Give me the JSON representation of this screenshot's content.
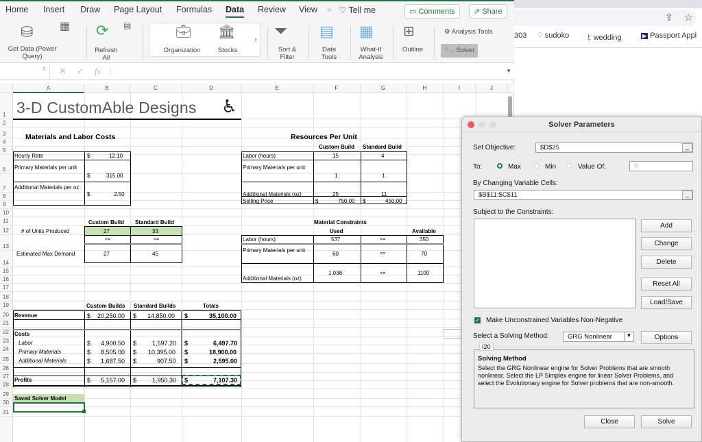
{
  "browser": {
    "bookmarks": [
      {
        "label": "303",
        "icon": "page-icon"
      },
      {
        "label": "sudoko",
        "icon": "bulb-icon"
      },
      {
        "label": "wedding",
        "icon": "wedding-icon"
      },
      {
        "label": "Passport Appl",
        "icon": "usps-icon"
      }
    ],
    "share_icon": "share-icon",
    "star_icon": "star-icon"
  },
  "excel": {
    "menu_tabs": [
      "Home",
      "Insert",
      "Draw",
      "Page Layout",
      "Formulas",
      "Data",
      "Review",
      "View"
    ],
    "active_tab": "Data",
    "tell_me": "Tell me",
    "comments_label": "Comments",
    "share_label": "Share",
    "ribbon": {
      "get_data": "Get Data (Power Query)",
      "refresh_all": "Refresh All",
      "organization": "Organization",
      "stocks": "Stocks",
      "sort_filter": "Sort & Filter",
      "data_tools": "Data Tools",
      "what_if": "What-If Analysis",
      "outline": "Outline",
      "analysis_tools": "Analysis Tools",
      "solver": "Solver"
    },
    "formula_bar": {
      "name_box": "",
      "fx": "fx",
      "value": ""
    },
    "columns": [
      "A",
      "B",
      "C",
      "D",
      "E",
      "F",
      "G",
      "H",
      "I",
      "J"
    ],
    "selected_column": "A",
    "rows": [
      "1",
      "2",
      "3",
      "4",
      "5",
      "6",
      "7",
      "8",
      "9",
      "10",
      "11",
      "12",
      "13",
      "14",
      "15",
      "16",
      "17",
      "18",
      "19",
      "20",
      "21",
      "22",
      "23",
      "24",
      "25",
      "26",
      "27",
      "28",
      "29",
      "30",
      "31"
    ],
    "selected_row": "28",
    "sheet": {
      "title": "3-D CustomAble Designs",
      "logo_icon": "wheelchair-icon",
      "materials": {
        "heading": "Materials and Labor Costs",
        "rows": [
          {
            "label": "Hourly Rate",
            "cur": "$",
            "value": "12.10"
          },
          {
            "label": "Primary Materials per unit",
            "cur": "$",
            "value": "315.00"
          },
          {
            "label": "Additional Materials per oz",
            "cur": "$",
            "value": "2.50"
          }
        ]
      },
      "resources": {
        "heading": "Resources Per Unit",
        "col1": "Custom Build",
        "col2": "Standard Build",
        "rows": [
          {
            "label": "Labor (hours)",
            "custom": "15",
            "standard": "4"
          },
          {
            "label": "Primary Materials per unit",
            "custom": "1",
            "standard": "1"
          },
          {
            "label": "Additional Materials (oz)",
            "custom": "25",
            "standard": "11"
          },
          {
            "label": "Selling Price",
            "custom": "750.00",
            "standard": "450.00",
            "cur": "$"
          }
        ]
      },
      "production": {
        "col1": "Custom Build",
        "col2": "Standard Build",
        "units_label": "# of Units Produced",
        "units_custom": "27",
        "units_standard": "33",
        "le_symbol": "<=",
        "demand_label": "Estimated Max Demand",
        "demand_custom": "27",
        "demand_standard": "45"
      },
      "constraints": {
        "heading": "Material Constraints",
        "used_header": "Used",
        "available_header": "Available",
        "rows": [
          {
            "label": "Labor (hours)",
            "used": "537",
            "op": "<=",
            "available": "350"
          },
          {
            "label": "Primary Materials per unit",
            "used": "60",
            "op": "<=",
            "available": "70"
          },
          {
            "label": "Additional Materials (oz)",
            "used": "1,038",
            "op": "<=",
            "available": "1100"
          }
        ]
      },
      "financials": {
        "headers": [
          "Custom Builds",
          "Standard Builds",
          "Totals"
        ],
        "revenue": {
          "label": "Revenue",
          "custom": "20,250.00",
          "standard": "14,850.00",
          "total": "35,100.00"
        },
        "costs_label": "Costs",
        "costs": [
          {
            "label": "Labor",
            "custom": "4,900.50",
            "standard": "1,597.20",
            "total": "6,497.70"
          },
          {
            "label": "Primary Materials",
            "custom": "8,505.00",
            "standard": "10,395.00",
            "total": "18,900.00"
          },
          {
            "label": "Additional Materials",
            "custom": "1,687.50",
            "standard": "907.50",
            "total": "2,595.00"
          }
        ],
        "profits": {
          "label": "Profits",
          "custom": "5,157.00",
          "standard": "1,950.30",
          "total": "7,107.30"
        },
        "cur": "$"
      },
      "saved_model_label": "Saved Solver Model"
    }
  },
  "solver": {
    "title": "Solver Parameters",
    "set_objective_label": "Set Objective:",
    "set_objective_value": "$D$25",
    "to_label": "To:",
    "options": [
      {
        "label": "Max",
        "selected": true
      },
      {
        "label": "Min",
        "selected": false
      },
      {
        "label": "Value Of:",
        "selected": false
      }
    ],
    "value_of": "0",
    "changing_cells_label": "By Changing Variable Cells:",
    "changing_cells_value": "$B$11:$C$11",
    "constraints_label": "Subject to the Constraints:",
    "constraints": [],
    "buttons": {
      "add": "Add",
      "change": "Change",
      "delete": "Delete",
      "reset_all": "Reset All",
      "load_save": "Load/Save",
      "options": "Options",
      "close": "Close",
      "solve": "Solve"
    },
    "non_negative_label": "Make Unconstrained Variables Non-Negative",
    "non_negative_checked": true,
    "method_label": "Select a Solving Method:",
    "method_value": "GRG Nonlinear",
    "tooltip": "I20",
    "help_title": "Solving Method",
    "help_text": "Select the GRG Nonlinear engine for Solver Problems that are smooth nonlinear. Select the LP Simplex engine for linear Solver Problems, and select the Evolutionary engine for Solver problems that are non-smooth."
  }
}
